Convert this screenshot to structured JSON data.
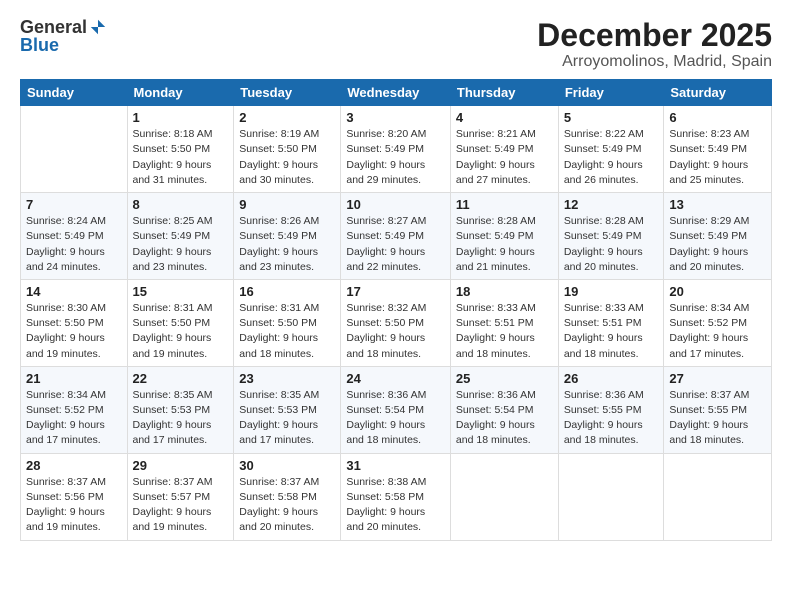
{
  "logo": {
    "general": "General",
    "blue": "Blue"
  },
  "title": "December 2025",
  "location": "Arroyomolinos, Madrid, Spain",
  "days_of_week": [
    "Sunday",
    "Monday",
    "Tuesday",
    "Wednesday",
    "Thursday",
    "Friday",
    "Saturday"
  ],
  "weeks": [
    [
      {
        "day": "",
        "sunrise": "",
        "sunset": "",
        "daylight": ""
      },
      {
        "day": "1",
        "sunrise": "Sunrise: 8:18 AM",
        "sunset": "Sunset: 5:50 PM",
        "daylight": "Daylight: 9 hours and 31 minutes."
      },
      {
        "day": "2",
        "sunrise": "Sunrise: 8:19 AM",
        "sunset": "Sunset: 5:50 PM",
        "daylight": "Daylight: 9 hours and 30 minutes."
      },
      {
        "day": "3",
        "sunrise": "Sunrise: 8:20 AM",
        "sunset": "Sunset: 5:49 PM",
        "daylight": "Daylight: 9 hours and 29 minutes."
      },
      {
        "day": "4",
        "sunrise": "Sunrise: 8:21 AM",
        "sunset": "Sunset: 5:49 PM",
        "daylight": "Daylight: 9 hours and 27 minutes."
      },
      {
        "day": "5",
        "sunrise": "Sunrise: 8:22 AM",
        "sunset": "Sunset: 5:49 PM",
        "daylight": "Daylight: 9 hours and 26 minutes."
      },
      {
        "day": "6",
        "sunrise": "Sunrise: 8:23 AM",
        "sunset": "Sunset: 5:49 PM",
        "daylight": "Daylight: 9 hours and 25 minutes."
      }
    ],
    [
      {
        "day": "7",
        "sunrise": "Sunrise: 8:24 AM",
        "sunset": "Sunset: 5:49 PM",
        "daylight": "Daylight: 9 hours and 24 minutes."
      },
      {
        "day": "8",
        "sunrise": "Sunrise: 8:25 AM",
        "sunset": "Sunset: 5:49 PM",
        "daylight": "Daylight: 9 hours and 23 minutes."
      },
      {
        "day": "9",
        "sunrise": "Sunrise: 8:26 AM",
        "sunset": "Sunset: 5:49 PM",
        "daylight": "Daylight: 9 hours and 23 minutes."
      },
      {
        "day": "10",
        "sunrise": "Sunrise: 8:27 AM",
        "sunset": "Sunset: 5:49 PM",
        "daylight": "Daylight: 9 hours and 22 minutes."
      },
      {
        "day": "11",
        "sunrise": "Sunrise: 8:28 AM",
        "sunset": "Sunset: 5:49 PM",
        "daylight": "Daylight: 9 hours and 21 minutes."
      },
      {
        "day": "12",
        "sunrise": "Sunrise: 8:28 AM",
        "sunset": "Sunset: 5:49 PM",
        "daylight": "Daylight: 9 hours and 20 minutes."
      },
      {
        "day": "13",
        "sunrise": "Sunrise: 8:29 AM",
        "sunset": "Sunset: 5:49 PM",
        "daylight": "Daylight: 9 hours and 20 minutes."
      }
    ],
    [
      {
        "day": "14",
        "sunrise": "Sunrise: 8:30 AM",
        "sunset": "Sunset: 5:50 PM",
        "daylight": "Daylight: 9 hours and 19 minutes."
      },
      {
        "day": "15",
        "sunrise": "Sunrise: 8:31 AM",
        "sunset": "Sunset: 5:50 PM",
        "daylight": "Daylight: 9 hours and 19 minutes."
      },
      {
        "day": "16",
        "sunrise": "Sunrise: 8:31 AM",
        "sunset": "Sunset: 5:50 PM",
        "daylight": "Daylight: 9 hours and 18 minutes."
      },
      {
        "day": "17",
        "sunrise": "Sunrise: 8:32 AM",
        "sunset": "Sunset: 5:50 PM",
        "daylight": "Daylight: 9 hours and 18 minutes."
      },
      {
        "day": "18",
        "sunrise": "Sunrise: 8:33 AM",
        "sunset": "Sunset: 5:51 PM",
        "daylight": "Daylight: 9 hours and 18 minutes."
      },
      {
        "day": "19",
        "sunrise": "Sunrise: 8:33 AM",
        "sunset": "Sunset: 5:51 PM",
        "daylight": "Daylight: 9 hours and 18 minutes."
      },
      {
        "day": "20",
        "sunrise": "Sunrise: 8:34 AM",
        "sunset": "Sunset: 5:52 PM",
        "daylight": "Daylight: 9 hours and 17 minutes."
      }
    ],
    [
      {
        "day": "21",
        "sunrise": "Sunrise: 8:34 AM",
        "sunset": "Sunset: 5:52 PM",
        "daylight": "Daylight: 9 hours and 17 minutes."
      },
      {
        "day": "22",
        "sunrise": "Sunrise: 8:35 AM",
        "sunset": "Sunset: 5:53 PM",
        "daylight": "Daylight: 9 hours and 17 minutes."
      },
      {
        "day": "23",
        "sunrise": "Sunrise: 8:35 AM",
        "sunset": "Sunset: 5:53 PM",
        "daylight": "Daylight: 9 hours and 17 minutes."
      },
      {
        "day": "24",
        "sunrise": "Sunrise: 8:36 AM",
        "sunset": "Sunset: 5:54 PM",
        "daylight": "Daylight: 9 hours and 18 minutes."
      },
      {
        "day": "25",
        "sunrise": "Sunrise: 8:36 AM",
        "sunset": "Sunset: 5:54 PM",
        "daylight": "Daylight: 9 hours and 18 minutes."
      },
      {
        "day": "26",
        "sunrise": "Sunrise: 8:36 AM",
        "sunset": "Sunset: 5:55 PM",
        "daylight": "Daylight: 9 hours and 18 minutes."
      },
      {
        "day": "27",
        "sunrise": "Sunrise: 8:37 AM",
        "sunset": "Sunset: 5:55 PM",
        "daylight": "Daylight: 9 hours and 18 minutes."
      }
    ],
    [
      {
        "day": "28",
        "sunrise": "Sunrise: 8:37 AM",
        "sunset": "Sunset: 5:56 PM",
        "daylight": "Daylight: 9 hours and 19 minutes."
      },
      {
        "day": "29",
        "sunrise": "Sunrise: 8:37 AM",
        "sunset": "Sunset: 5:57 PM",
        "daylight": "Daylight: 9 hours and 19 minutes."
      },
      {
        "day": "30",
        "sunrise": "Sunrise: 8:37 AM",
        "sunset": "Sunset: 5:58 PM",
        "daylight": "Daylight: 9 hours and 20 minutes."
      },
      {
        "day": "31",
        "sunrise": "Sunrise: 8:38 AM",
        "sunset": "Sunset: 5:58 PM",
        "daylight": "Daylight: 9 hours and 20 minutes."
      },
      {
        "day": "",
        "sunrise": "",
        "sunset": "",
        "daylight": ""
      },
      {
        "day": "",
        "sunrise": "",
        "sunset": "",
        "daylight": ""
      },
      {
        "day": "",
        "sunrise": "",
        "sunset": "",
        "daylight": ""
      }
    ]
  ]
}
